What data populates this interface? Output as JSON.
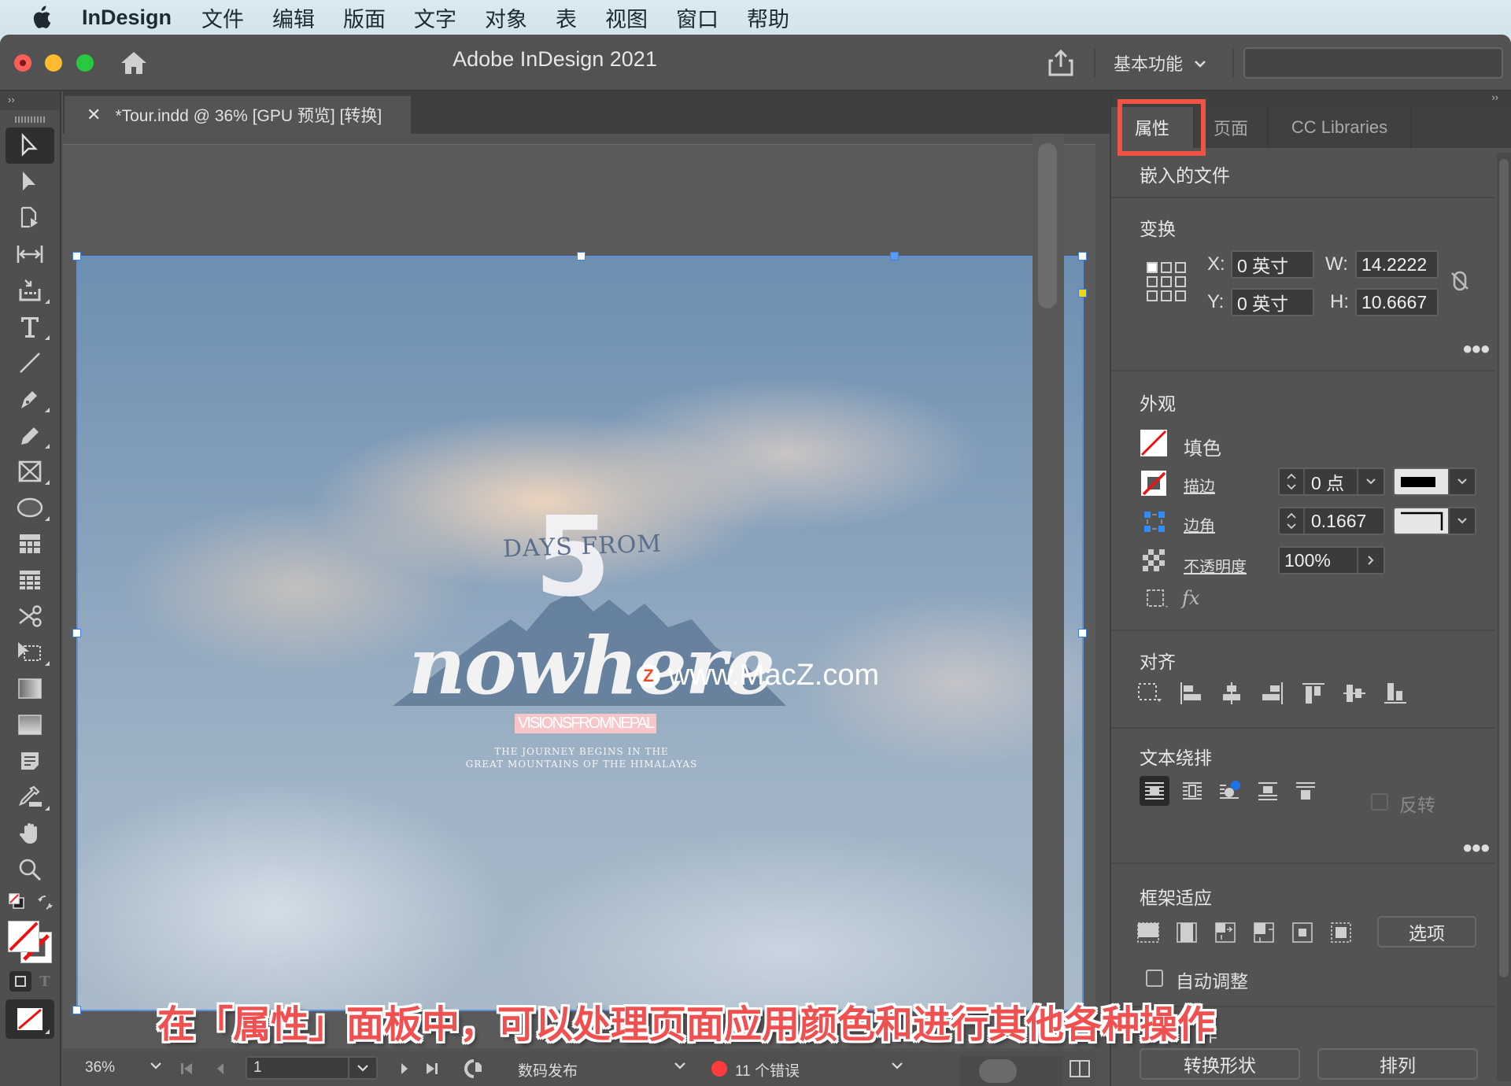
{
  "menubar": {
    "app": "InDesign",
    "items": [
      "文件",
      "编辑",
      "版面",
      "文字",
      "对象",
      "表",
      "视图",
      "窗口",
      "帮助"
    ]
  },
  "titlebar": {
    "title": "Adobe InDesign 2021",
    "workspace": "基本功能",
    "search_value": ""
  },
  "document": {
    "tab_label": "*Tour.indd @ 36% [GPU 预览] [转换]"
  },
  "page_content": {
    "number": "5",
    "days_from": "DAYS FROM",
    "nowhere": "nowhere",
    "vision": "VISIONSFROMNEPAL",
    "subtitle_line1": "THE JOURNEY BEGINS IN THE",
    "subtitle_line2": "GREAT MOUNTAINS OF THE HIMALAYAS",
    "watermark": "www.MacZ.com",
    "watermark_badge": "Z"
  },
  "caption": "在「属性」面板中，可以处理页面应用颜色和进行其他各种操作",
  "status": {
    "zoom": "36%",
    "page": "1",
    "preflight_profile": "数码发布",
    "errors": "11 个错误",
    "error_color": "#ff3b3b"
  },
  "panel": {
    "tabs": [
      {
        "label": "属性",
        "active": true
      },
      {
        "label": "页面",
        "active": false
      },
      {
        "label": "CC Libraries",
        "active": false
      }
    ],
    "object_type": "嵌入的文件",
    "transform": {
      "title": "变换",
      "x_label": "X:",
      "x": "0 英寸",
      "y_label": "Y:",
      "y": "0 英寸",
      "w_label": "W:",
      "w": "14.2222",
      "h_label": "H:",
      "h": "10.6667"
    },
    "appearance": {
      "title": "外观",
      "fill_label": "填色",
      "stroke_label": "描边",
      "stroke_weight": "0 点",
      "corner_label": "边角",
      "corner_value": "0.1667",
      "opacity_label": "不透明度",
      "opacity_value": "100%"
    },
    "align": {
      "title": "对齐"
    },
    "text_wrap": {
      "title": "文本绕排",
      "invert_label": "反转",
      "invert_checked": false
    },
    "frame_fitting": {
      "title": "框架适应",
      "options_label": "选项",
      "auto_fit_label": "自动调整",
      "auto_fit_checked": false
    },
    "quick_actions": {
      "title_partial": "作",
      "convert_shape": "转换形状",
      "arrange": "排列"
    }
  },
  "colors": {
    "highlight": "#f05245",
    "selection": "#3d7fe0",
    "accent_blue": "#1a73e8"
  }
}
